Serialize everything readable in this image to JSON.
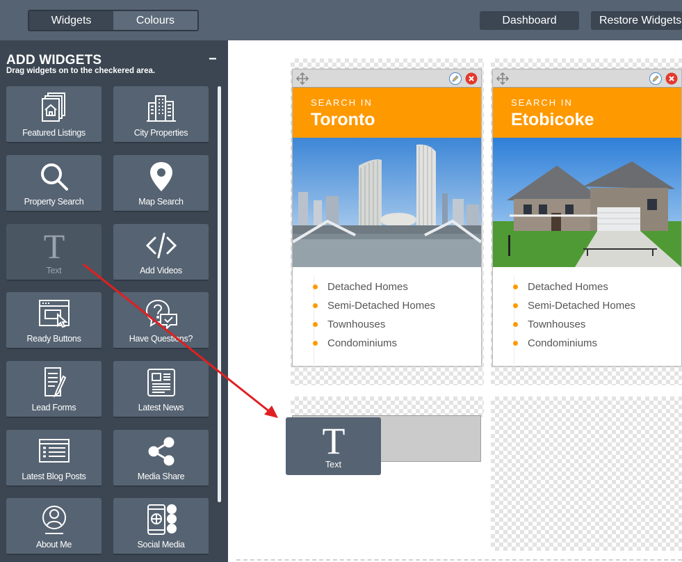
{
  "toolbar": {
    "tab_widgets": "Widgets",
    "tab_colours": "Colours",
    "dashboard": "Dashboard",
    "restore": "Restore Widgets"
  },
  "sidebar": {
    "title": "ADD WIDGETS",
    "subtitle": "Drag widgets on to the checkered area.",
    "collapse": "−",
    "widgets": [
      {
        "label": "Featured Listings",
        "icon": "featured-listings-icon"
      },
      {
        "label": "City Properties",
        "icon": "city-buildings-icon"
      },
      {
        "label": "Property Search",
        "icon": "search-icon"
      },
      {
        "label": "Map Search",
        "icon": "map-pin-icon"
      },
      {
        "label": "Text",
        "icon": "text-icon"
      },
      {
        "label": "Add Videos",
        "icon": "code-icon"
      },
      {
        "label": "Ready Buttons",
        "icon": "browser-cursor-icon"
      },
      {
        "label": "Have Questions?",
        "icon": "question-chat-icon"
      },
      {
        "label": "Lead Forms",
        "icon": "form-pen-icon"
      },
      {
        "label": "Latest News",
        "icon": "newspaper-icon"
      },
      {
        "label": "Latest Blog Posts",
        "icon": "blog-list-icon"
      },
      {
        "label": "Media Share",
        "icon": "share-icon"
      },
      {
        "label": "About Me",
        "icon": "user-circle-icon"
      },
      {
        "label": "Social Media",
        "icon": "social-phone-icon"
      }
    ]
  },
  "cards": [
    {
      "kicker": "SEARCH IN",
      "city": "Toronto",
      "items": [
        "Detached Homes",
        "Semi-Detached Homes",
        "Townhouses",
        "Condominiums"
      ]
    },
    {
      "kicker": "SEARCH IN",
      "city": "Etobicoke",
      "items": [
        "Detached Homes",
        "Semi-Detached Homes",
        "Townhouses",
        "Condominiums"
      ]
    }
  ],
  "dragging": {
    "label": "Text",
    "icon": "text-icon"
  },
  "colors": {
    "orange": "#ff9900",
    "slate": "#566372",
    "dark": "#3b4652",
    "arrow": "#e02020"
  }
}
